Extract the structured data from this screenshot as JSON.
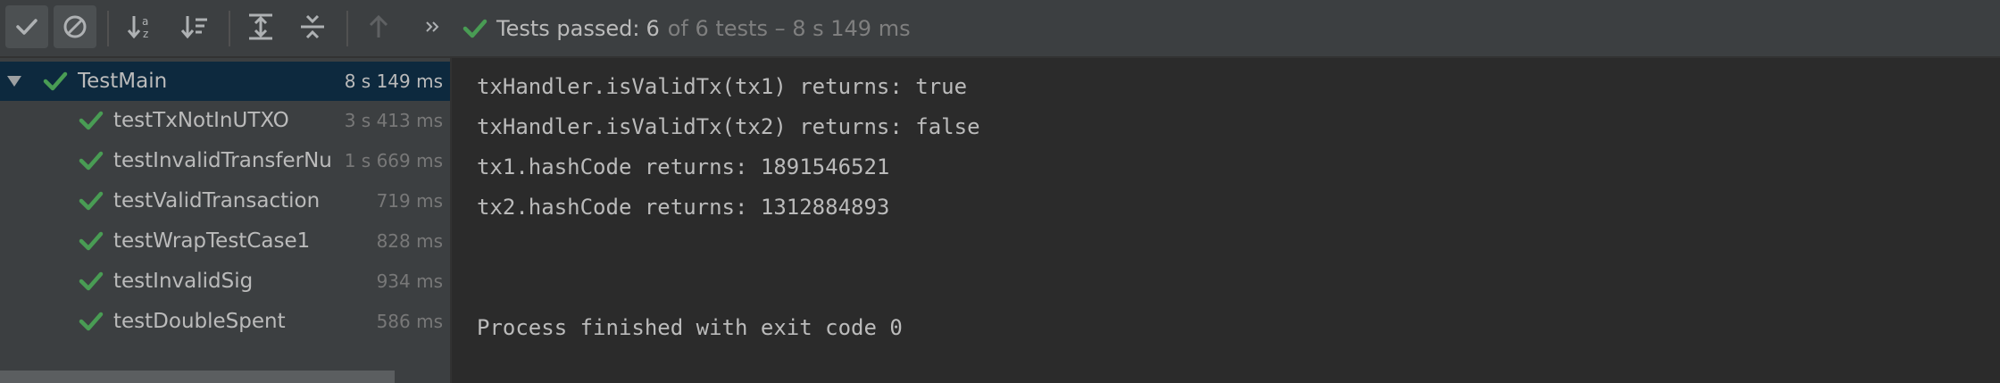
{
  "toolbar": {
    "buttons": [
      {
        "name": "show-passed-button",
        "icon": "checkmark-icon",
        "active": true
      },
      {
        "name": "show-ignored-button",
        "icon": "no-entry-icon",
        "active": true
      },
      {
        "name": "sort-alphabetically-button",
        "icon": "sort-alpha-icon",
        "active": false
      },
      {
        "name": "sort-by-duration-button",
        "icon": "sort-duration-icon",
        "active": false
      },
      {
        "name": "expand-all-button",
        "icon": "expand-all-icon",
        "active": false
      },
      {
        "name": "collapse-all-button",
        "icon": "collapse-all-icon",
        "active": false
      },
      {
        "name": "previous-failed-button",
        "icon": "arrow-up-icon",
        "active": false
      },
      {
        "name": "more-button",
        "icon": "double-chevron-right-icon",
        "active": false
      }
    ],
    "status": {
      "icon": "checkmark-icon",
      "prefix": "Tests passed:",
      "count": "6",
      "rest": "of 6 tests – 8 s 149 ms"
    }
  },
  "colors": {
    "check_green": "#499c54",
    "selected_row": "#0d293e",
    "panel_bg": "#3c3f41",
    "console_bg": "#2b2b2b"
  },
  "tree": {
    "root": {
      "label": "TestMain",
      "time": "8 s 149 ms",
      "expanded": true
    },
    "tests": [
      {
        "label": "testTxNotInUTXO",
        "time": "3 s 413 ms"
      },
      {
        "label": "testInvalidTransferNu",
        "time": "1 s 669 ms"
      },
      {
        "label": "testValidTransaction",
        "time": "719 ms"
      },
      {
        "label": "testWrapTestCase1",
        "time": "828 ms"
      },
      {
        "label": "testInvalidSig",
        "time": "934 ms"
      },
      {
        "label": "testDoubleSpent",
        "time": "586 ms"
      }
    ]
  },
  "console": {
    "lines": [
      "txHandler.isValidTx(tx1) returns: true",
      "txHandler.isValidTx(tx2) returns: false",
      "tx1.hashCode returns: 1891546521",
      "tx2.hashCode returns: 1312884893",
      "",
      "",
      "Process finished with exit code 0"
    ]
  }
}
